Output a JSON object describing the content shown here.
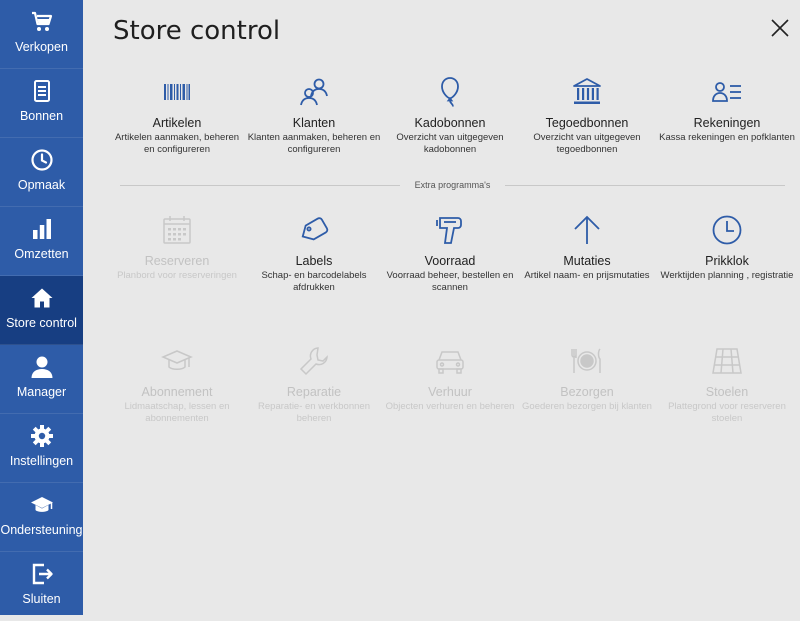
{
  "colors": {
    "sidebar_bg": "#2e5ca8",
    "sidebar_active": "#173e82",
    "icon_blue": "#2e5ca8",
    "disabled": "#c8c8c8"
  },
  "sidebar": {
    "items": [
      {
        "label": "Verkopen",
        "icon": "cart-icon"
      },
      {
        "label": "Bonnen",
        "icon": "receipt-icon"
      },
      {
        "label": "Opmaak",
        "icon": "clock-icon"
      },
      {
        "label": "Omzetten",
        "icon": "bar-chart-icon"
      },
      {
        "label": "Store control",
        "icon": "home-icon",
        "active": true
      },
      {
        "label": "Manager",
        "icon": "user-icon"
      },
      {
        "label": "Instellingen",
        "icon": "gear-icon"
      },
      {
        "label": "Ondersteuning",
        "icon": "graduation-cap-icon"
      },
      {
        "label": "Sluiten",
        "icon": "exit-icon"
      }
    ]
  },
  "header": {
    "title": "Store control"
  },
  "primary": [
    {
      "title": "Artikelen",
      "desc": "Artikelen aanmaken, beheren en configureren",
      "icon": "barcode-icon"
    },
    {
      "title": "Klanten",
      "desc": "Klanten aanmaken, beheren en configureren",
      "icon": "customers-icon"
    },
    {
      "title": "Kadobonnen",
      "desc": "Overzicht van uitgegeven kadobonnen",
      "icon": "balloon-icon"
    },
    {
      "title": "Tegoedbonnen",
      "desc": "Overzicht van uitgegeven tegoedbonnen",
      "icon": "bank-icon"
    },
    {
      "title": "Rekeningen",
      "desc": "Kassa rekeningen en pofklanten",
      "icon": "account-list-icon"
    }
  ],
  "divider_label": "Extra programma's",
  "extra_row1": [
    {
      "title": "Reserveren",
      "desc": "Planbord voor reserveringen",
      "icon": "calendar-icon",
      "disabled": true
    },
    {
      "title": "Labels",
      "desc": "Schap- en barcodelabels afdrukken",
      "icon": "tag-icon"
    },
    {
      "title": "Voorraad",
      "desc": "Voorraad beheer, bestellen en scannen",
      "icon": "scanner-icon"
    },
    {
      "title": "Mutaties",
      "desc": "Artikel naam- en prijsmutaties",
      "icon": "arrow-up-icon"
    },
    {
      "title": "Prikklok",
      "desc": "Werktijden planning , registratie",
      "icon": "clock-icon"
    }
  ],
  "extra_row2": [
    {
      "title": "Abonnement",
      "desc": "Lidmaatschap, lessen en abonnementen",
      "icon": "graduation-cap-icon",
      "disabled": true
    },
    {
      "title": "Reparatie",
      "desc": "Reparatie- en werkbonnen beheren",
      "icon": "wrench-icon",
      "disabled": true
    },
    {
      "title": "Verhuur",
      "desc": "Objecten verhuren en beheren",
      "icon": "car-icon",
      "disabled": true
    },
    {
      "title": "Bezorgen",
      "desc": "Goederen bezorgen bij klanten",
      "icon": "plate-icon",
      "disabled": true
    },
    {
      "title": "Stoelen",
      "desc": "Plattegrond voor reserveren stoelen",
      "icon": "floorplan-icon",
      "disabled": true
    }
  ]
}
